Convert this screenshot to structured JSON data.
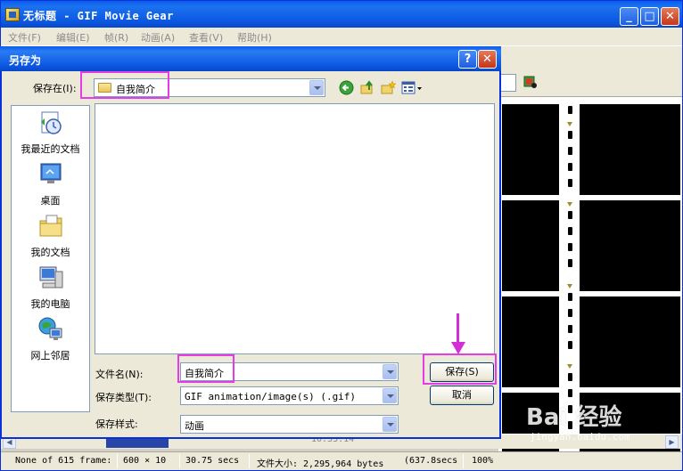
{
  "main_window": {
    "title": "无标题 - GIF Movie Gear",
    "minimize_glyph": "_",
    "maximize_glyph": "□",
    "close_glyph": "✕"
  },
  "menubar": {
    "items": [
      {
        "label": "文件(F)"
      },
      {
        "label": "编辑(E)"
      },
      {
        "label": "帧(R)"
      },
      {
        "label": "动画(A)"
      },
      {
        "label": "查看(V)"
      },
      {
        "label": "帮助(H)"
      }
    ]
  },
  "timeline": {
    "time_label": "10:33:14"
  },
  "statusbar": {
    "frame_info": "None of 615 frame:",
    "dimensions": "600 × 10",
    "duration": "30.75 secs",
    "file_size": "文件大小: 2,295,964 bytes",
    "secs_extra": "(637.8secs",
    "zoom": "100%"
  },
  "dialog": {
    "title": "另存为",
    "help_glyph": "?",
    "close_glyph": "✕",
    "save_in_label": "保存在(I):",
    "save_in_value": "自我简介",
    "places": [
      {
        "label": "我最近的文档",
        "icon": "recent-documents-icon"
      },
      {
        "label": "桌面",
        "icon": "desktop-icon"
      },
      {
        "label": "我的文档",
        "icon": "my-documents-icon"
      },
      {
        "label": "我的电脑",
        "icon": "my-computer-icon"
      },
      {
        "label": "网上邻居",
        "icon": "network-places-icon"
      }
    ],
    "filename_label": "文件名(N):",
    "filename_value": "自我简介",
    "filetype_label": "保存类型(T):",
    "filetype_value": "GIF animation/image(s) (.gif)",
    "savestyle_label": "保存样式:",
    "savestyle_value": "动画",
    "save_button": "保存(S)",
    "cancel_button": "取消"
  },
  "watermark": {
    "brand": "Bai 经验",
    "url": "jingyan.baidu.com"
  },
  "colors": {
    "highlight": "#e63ce6",
    "titlebar": "#0a5bee"
  }
}
